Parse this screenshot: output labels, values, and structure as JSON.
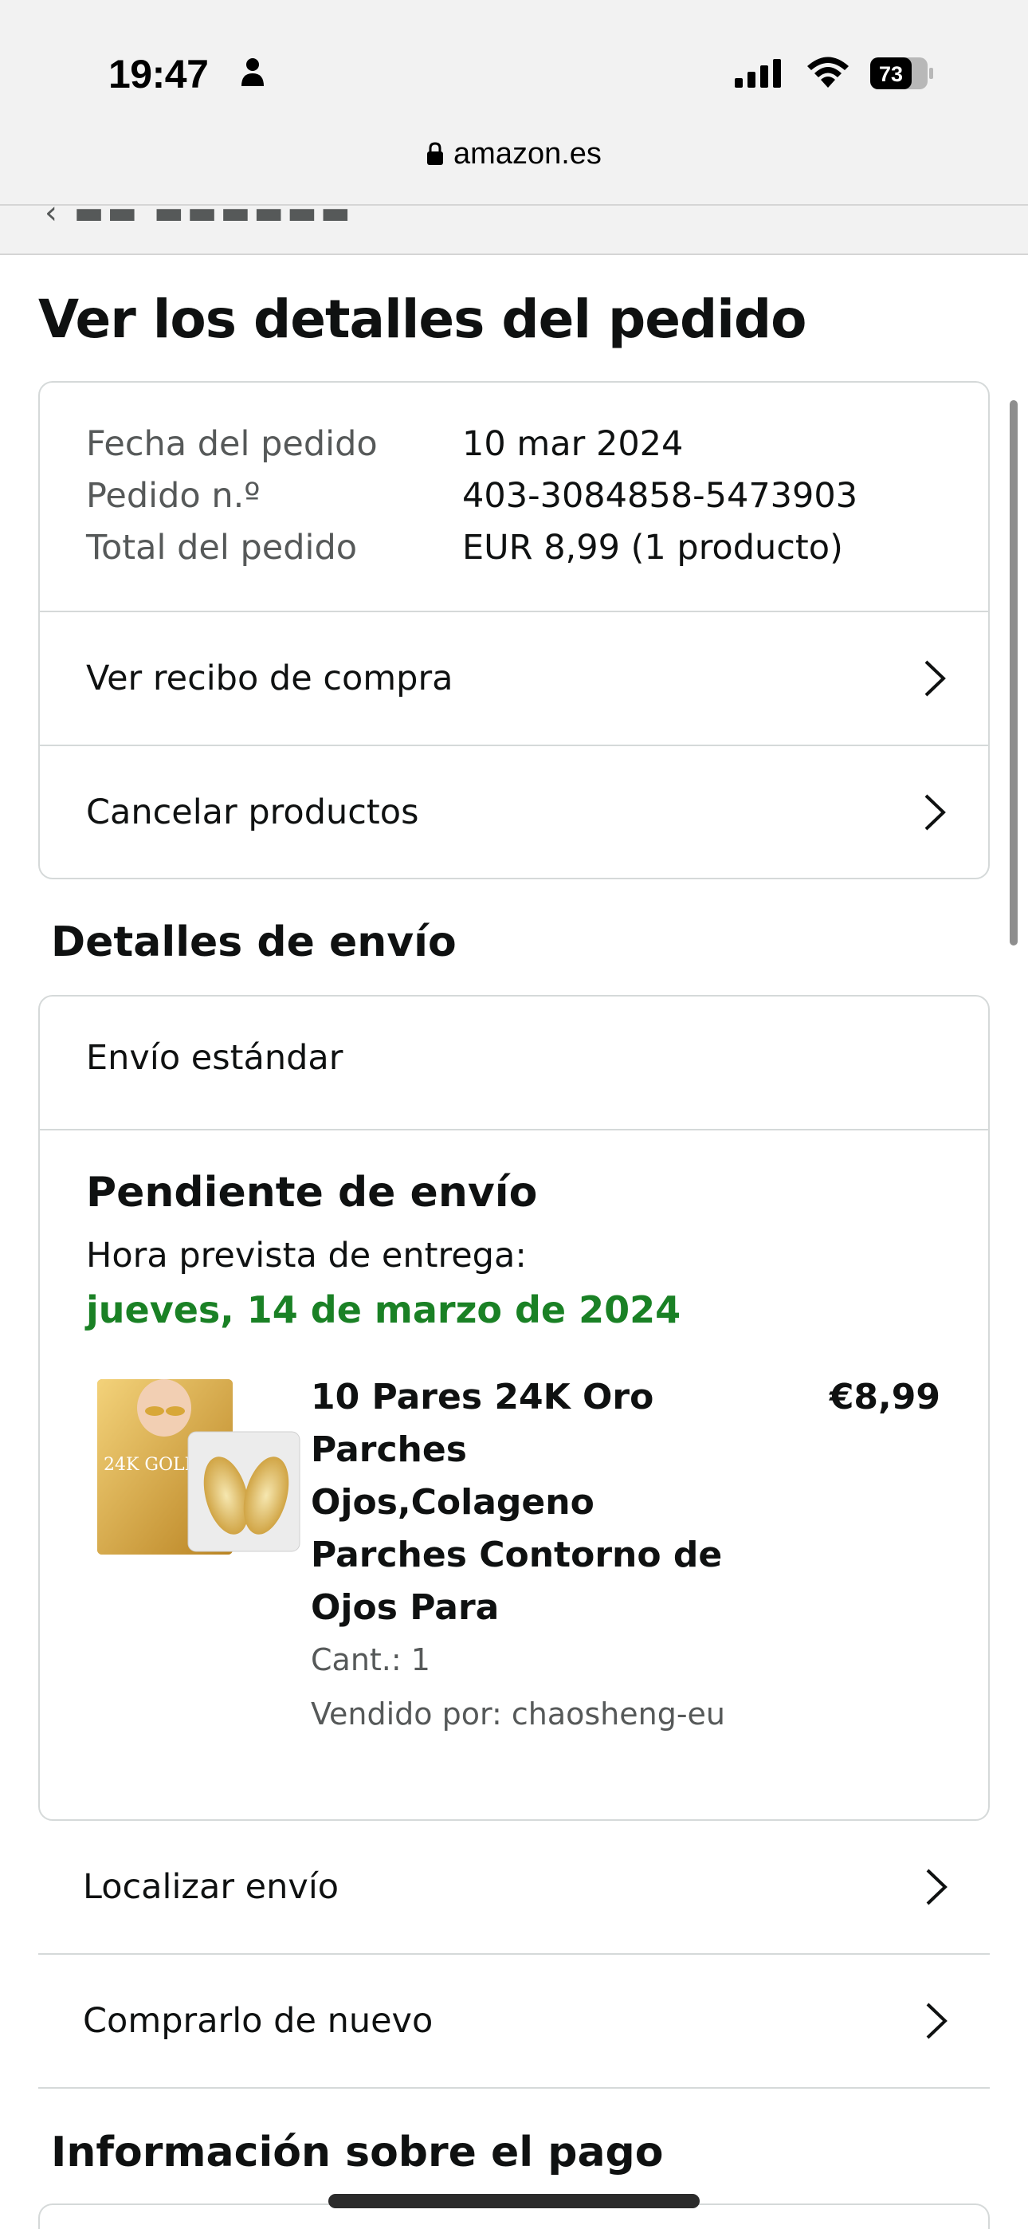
{
  "status_bar": {
    "time": "19:47",
    "battery_level": "73",
    "icons": [
      "person-icon",
      "signal-icon",
      "wifi-icon",
      "battery-icon"
    ]
  },
  "browser": {
    "url": "amazon.es",
    "lock_icon": "lock-icon"
  },
  "page": {
    "title": "Ver los detalles del pedido"
  },
  "order_summary": {
    "rows": [
      {
        "label": "Fecha del pedido",
        "value": "10 mar 2024"
      },
      {
        "label": "Pedido n.º",
        "value": "403-3084858-5473903"
      },
      {
        "label": "Total del pedido",
        "value": "EUR 8,99 (1 producto)"
      }
    ],
    "links": [
      {
        "label": "Ver recibo de compra"
      },
      {
        "label": "Cancelar productos"
      }
    ]
  },
  "shipping": {
    "section_title": "Detalles de envío",
    "method": "Envío estándar",
    "status": "Pendiente de envío",
    "eta_label": "Hora prevista de entrega:",
    "eta_date": "jueves, 14 de marzo de 2024",
    "eta_color": "#1a8125",
    "product": {
      "title": "10 Pares 24K Oro Parches Ojos,Colageno Parches Contorno de Ojos Para",
      "price": "€8,99",
      "quantity": "Cant.: 1",
      "seller": "Vendido por: chaosheng-eu",
      "image_text": "24K GOLD EYE MASK"
    },
    "links": [
      {
        "label": "Localizar envío"
      },
      {
        "label": "Comprarlo de nuevo"
      }
    ]
  },
  "payment": {
    "section_title": "Información sobre el pago"
  },
  "colors": {
    "text_primary": "#0f1111",
    "text_secondary": "#565959",
    "border": "#d5d9d9",
    "success_green": "#1a8125"
  }
}
